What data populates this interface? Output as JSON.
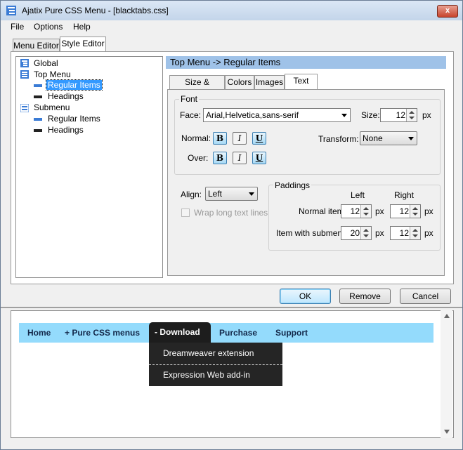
{
  "window": {
    "title": "Ajatix Pure CSS Menu - [blacktabs.css]",
    "close_label": "x"
  },
  "menubar": {
    "items": [
      "File",
      "Options",
      "Help"
    ]
  },
  "main_tabs": [
    "Menu Editor",
    "Style Editor"
  ],
  "tree": {
    "items": [
      {
        "label": "Global"
      },
      {
        "label": "Top Menu"
      },
      {
        "label": "Regular Items",
        "selected": true
      },
      {
        "label": "Headings"
      },
      {
        "label": "Submenu"
      },
      {
        "label": "Regular Items"
      },
      {
        "label": "Headings"
      }
    ]
  },
  "right_panel": {
    "header": "Top Menu -> Regular Items",
    "tabs": [
      "Size & Position",
      "Colors",
      "Images",
      "Text"
    ],
    "font_group": {
      "title": "Font",
      "face_label": "Face:",
      "face_value": "Arial,Helvetica,sans-serif",
      "size_label": "Size:",
      "size_value": "12",
      "size_unit": "px",
      "normal_label": "Normal:",
      "over_label": "Over:",
      "bold": "B",
      "italic": "I",
      "underline": "U",
      "transform_label": "Transform:",
      "transform_value": "None"
    },
    "align_label": "Align:",
    "align_value": "Left",
    "wrap_label": "Wrap long text lines",
    "paddings": {
      "title": "Paddings",
      "left_header": "Left",
      "right_header": "Right",
      "normal_label": "Normal item:",
      "normal_left": "12",
      "normal_right": "12",
      "submenu_label": "Item with submenu:",
      "submenu_left": "20",
      "submenu_right": "12",
      "unit": "px"
    }
  },
  "buttons": {
    "ok": "OK",
    "remove": "Remove",
    "cancel": "Cancel"
  },
  "preview": {
    "menu": [
      {
        "label": "Home"
      },
      {
        "label": "+ Pure CSS menus"
      },
      {
        "label": "- Download",
        "active": true
      },
      {
        "label": "Purchase"
      },
      {
        "label": "Support"
      }
    ],
    "dropdown": [
      "Dreamweaver extension",
      "Expression Web add-in"
    ],
    "colors": {
      "bar": "#94dbfc",
      "active": "#1d1d1d",
      "text": "#13284a"
    }
  }
}
